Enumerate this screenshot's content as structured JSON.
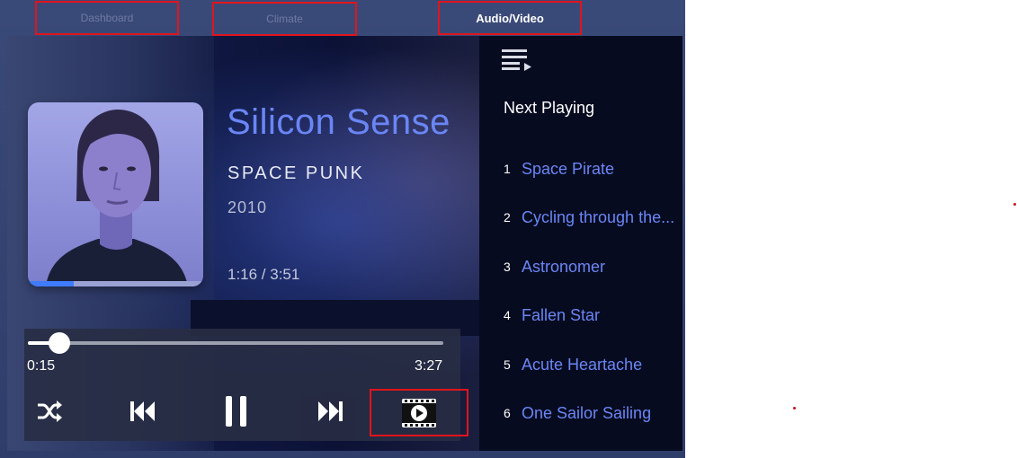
{
  "tabs": {
    "dashboard": "Dashboard",
    "climate": "Climate",
    "audio_video": "Audio/Video"
  },
  "now_playing": {
    "title": "Silicon Sense",
    "artist": "SPACE PUNK",
    "year": "2010",
    "time": "1:16 / 3:51",
    "album_progress_fraction": 0.26
  },
  "controls": {
    "elapsed": "0:15",
    "remaining": "3:27",
    "seek_fraction": 0.075
  },
  "queue": {
    "heading": "Next Playing",
    "items": [
      {
        "num": "1",
        "name": "Space Pirate"
      },
      {
        "num": "2",
        "name": "Cycling through the..."
      },
      {
        "num": "3",
        "name": "Astronomer"
      },
      {
        "num": "4",
        "name": "Fallen Star"
      },
      {
        "num": "5",
        "name": "Acute Heartache"
      },
      {
        "num": "6",
        "name": "One Sailor Sailing"
      }
    ]
  },
  "colors": {
    "accent": "#6a86f5",
    "highlight_border": "#e0141c",
    "queue_bg": "#070b20"
  },
  "icons": [
    "queue-list-icon",
    "shuffle-icon",
    "skip-previous-icon",
    "pause-icon",
    "skip-next-icon",
    "video-play-icon"
  ]
}
